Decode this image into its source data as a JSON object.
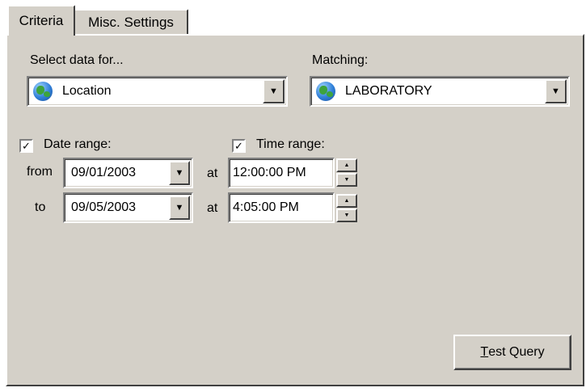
{
  "tabs": [
    {
      "label": "Criteria",
      "active": true
    },
    {
      "label": "Misc. Settings",
      "active": false
    }
  ],
  "select_data": {
    "label": "Select data for...",
    "value": "Location",
    "icon": "globe-icon"
  },
  "matching": {
    "label": "Matching:",
    "value": "LABORATORY",
    "icon": "globe-icon"
  },
  "date_range": {
    "label": "Date range:",
    "checked": true,
    "from_label": "from",
    "to_label": "to",
    "from_value": "09/01/2003",
    "to_value": "09/05/2003"
  },
  "time_range": {
    "label": "Time range:",
    "checked": true,
    "at_label": "at",
    "from_value": "12:00:00 PM",
    "to_value": "4:05:00 PM"
  },
  "test_query": {
    "accel": "T",
    "rest": "est Query"
  },
  "colors": {
    "face": "#d4d0c8",
    "highlight": "#ffffff",
    "shadow": "#808080",
    "dark_shadow": "#404040"
  }
}
